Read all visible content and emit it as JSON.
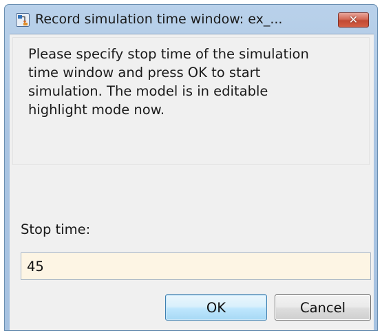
{
  "window": {
    "title": "Record simulation time window: ex_...",
    "title_icon": "simulink-model-icon",
    "close_glyph": "✕"
  },
  "message": {
    "lines": [
      "Please specify stop time of the simulation",
      "time window and press OK to start",
      "simulation. The model is in editable",
      "highlight mode now."
    ]
  },
  "stop_time": {
    "label": "Stop time:",
    "value": "45"
  },
  "buttons": {
    "ok": "OK",
    "cancel": "Cancel"
  },
  "colors": {
    "input_background": "#fdf5e4",
    "close_button": "#c24a34",
    "default_button": "#bee6fd"
  }
}
